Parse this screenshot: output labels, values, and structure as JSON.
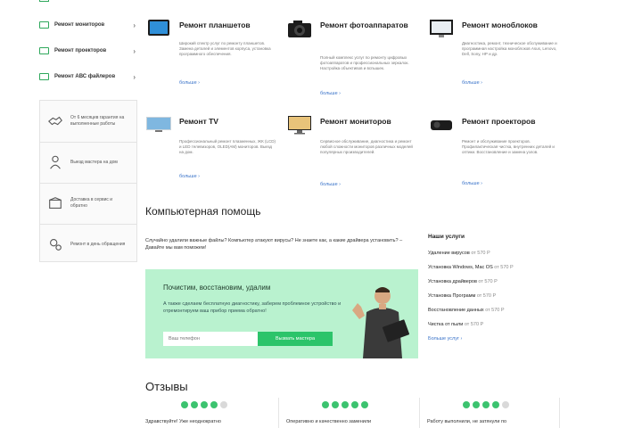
{
  "sidebar": {
    "menu": [
      {
        "label": "Ремонт мониторов",
        "icon": "monitor-icon"
      },
      {
        "label": "Ремонт проекторов",
        "icon": "projector-icon"
      },
      {
        "label": "Ремонт АВС файлеров",
        "icon": "device-icon"
      }
    ],
    "features": [
      {
        "text": "От 6 месяцев гарантия на выполненные работы",
        "icon": "handshake-icon"
      },
      {
        "text": "Выезд мастера на дом",
        "icon": "person-pin-icon"
      },
      {
        "text": "Доставка в сервис и обратно",
        "icon": "delivery-box-icon"
      },
      {
        "text": "Ремонт в день обращения",
        "icon": "gears-icon"
      }
    ]
  },
  "services": [
    {
      "title": "Ремонт планшетов",
      "desc": "Широкий спектр услуг по ремонту планшетов. Замена деталей и элементов корпуса, установка программного обеспечения.",
      "more": "больше ›",
      "icon": "tablet-icon"
    },
    {
      "title": "Ремонт фотоаппаратов",
      "desc": "Полный комплекс услуг по ремонту цифровых фотоаппаратов и профессиональных зеркалок. Настройка объективов и вспышек.",
      "more": "больше ›",
      "icon": "camera-icon"
    },
    {
      "title": "Ремонт моноблоков",
      "desc": "Диагностика, ремонт, техническое обслуживание и программная настройка моноблоков Asus, Lenovo, Dell, Sony, HP и др.",
      "more": "больше ›",
      "icon": "monoblock-icon"
    },
    {
      "title": "Ремонт TV",
      "desc": "Профессиональный ремонт плазменных, ЖК (LCD) и LED телевизоров, OLED(AM) мониторов. Выезд на дом.",
      "more": "больше ›",
      "icon": "tv-icon"
    },
    {
      "title": "Ремонт мониторов",
      "desc": "Сервисное обслуживание, диагностика и ремонт любой сложности мониторов различных моделей популярных производителей.",
      "more": "больше ›",
      "icon": "monitor-icon"
    },
    {
      "title": "Ремонт проекторов",
      "desc": "Ремонт и обслуживание проекторов. Профилактическая чистка, внутренних деталей и оптики. Восстановление и замена узлов.",
      "more": "больше ›",
      "icon": "projector-icon"
    }
  ],
  "help": {
    "title": "Компьютерная помощь",
    "intro": "Случайно удалили важные файлы? Компьютер атакуют вирусы? Не знаете как, а какие драйвера установить? – Давайте мы вам поможем!"
  },
  "banner": {
    "title": "Почистим, восстановим, удалим",
    "text": "А также сделаем бесплатную диагностику, заберем проблемное устройство и отремонтируем ваш прибор приема обратно!",
    "input_placeholder": "Ваш телефон",
    "button": "Вызвать мастера"
  },
  "our_services": {
    "title": "Наши услуги",
    "items": [
      {
        "name": "Удаление вирусов",
        "price": "от 570 Р"
      },
      {
        "name": "Установка Windows, Mac OS",
        "price": "от 570 Р"
      },
      {
        "name": "Установка драйверов",
        "price": "от 570 Р"
      },
      {
        "name": "Установка Программ",
        "price": "от 570 Р"
      },
      {
        "name": "Восстановление данных",
        "price": "от 570 Р"
      },
      {
        "name": "Чистка от пыли",
        "price": "от 570 Р"
      }
    ],
    "more": "Больше услуг ›"
  },
  "reviews": {
    "title": "Отзывы",
    "items": [
      {
        "stars": 4,
        "text": "Здравствуйте! Уже неоднократно"
      },
      {
        "stars": 5,
        "text": "Оперативно и качественно заменили"
      },
      {
        "stars": 4,
        "text": "Работу выполнили, не затянули по"
      }
    ]
  },
  "colors": {
    "accent": "#2cc46a",
    "banner_bg": "#b9f2cf",
    "link": "#3a73c9"
  }
}
